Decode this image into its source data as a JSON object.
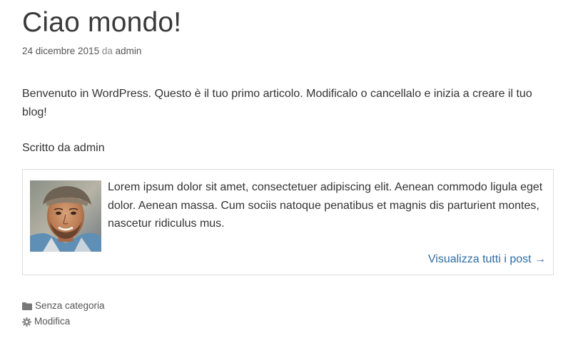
{
  "post": {
    "title": "Ciao mondo!",
    "date": "24 dicembre 2015",
    "by_word": "da",
    "author": "admin",
    "content": "Benvenuto in WordPress. Questo è il tuo primo articolo. Modificalo o cancellalo e inizia a creare il tuo blog!",
    "written_by": "Scritto da admin"
  },
  "author_box": {
    "bio": "Lorem ipsum dolor sit amet, consectetuer adipiscing elit. Aenean commodo ligula eget dolor. Aenean massa. Cum sociis natoque penatibus et magnis dis parturient montes, nascetur ridiculus mus.",
    "view_all_label": "Visualizza tutti i post →",
    "avatar_alt": "Author avatar"
  },
  "footer": {
    "category_icon": "folder-icon",
    "category": "Senza categoria",
    "edit_icon": "gear-icon",
    "edit_label": "Modifica"
  },
  "colors": {
    "link": "#2e6ca4",
    "text": "#333333",
    "meta": "#555555",
    "border": "#dddddd"
  }
}
